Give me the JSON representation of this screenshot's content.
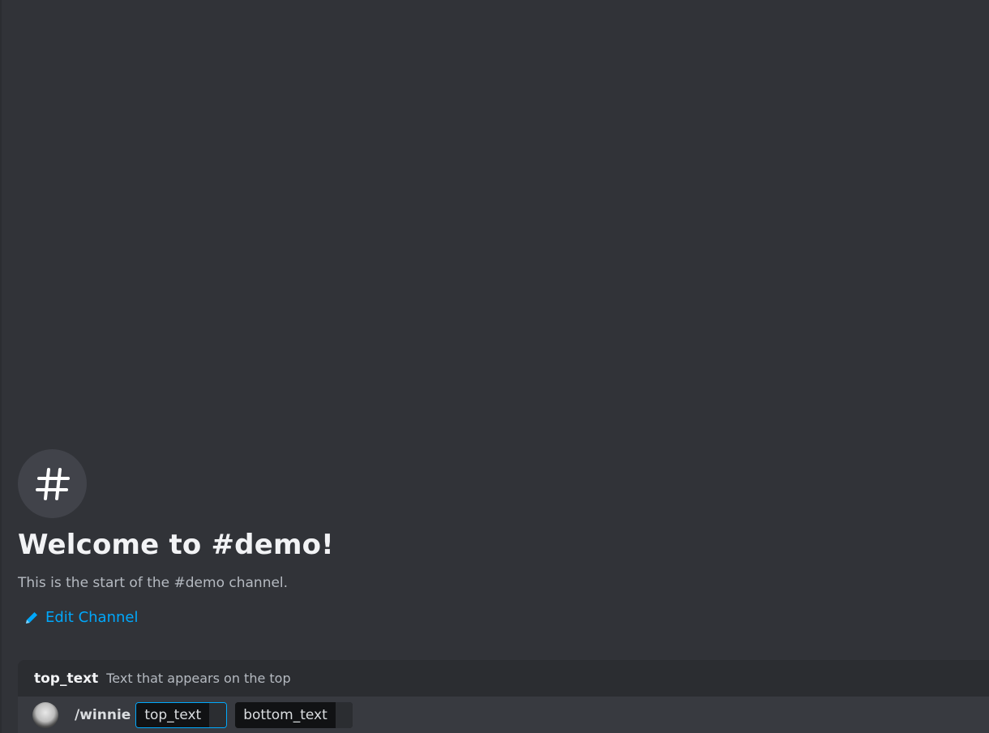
{
  "channel": {
    "icon": "hashtag-icon",
    "welcome_title": "Welcome to #demo!",
    "welcome_subtitle": "This is the start of the #demo channel.",
    "edit_label": "Edit Channel"
  },
  "command": {
    "hint_option_name": "top_text",
    "hint_option_description": "Text that appears on the top",
    "name": "/winnie",
    "params": [
      {
        "label": "top_text",
        "active": true
      },
      {
        "label": "bottom_text",
        "active": false
      }
    ]
  },
  "colors": {
    "background": "#313338",
    "accent_link": "#00a8fc",
    "title": "#f2f3f5"
  }
}
